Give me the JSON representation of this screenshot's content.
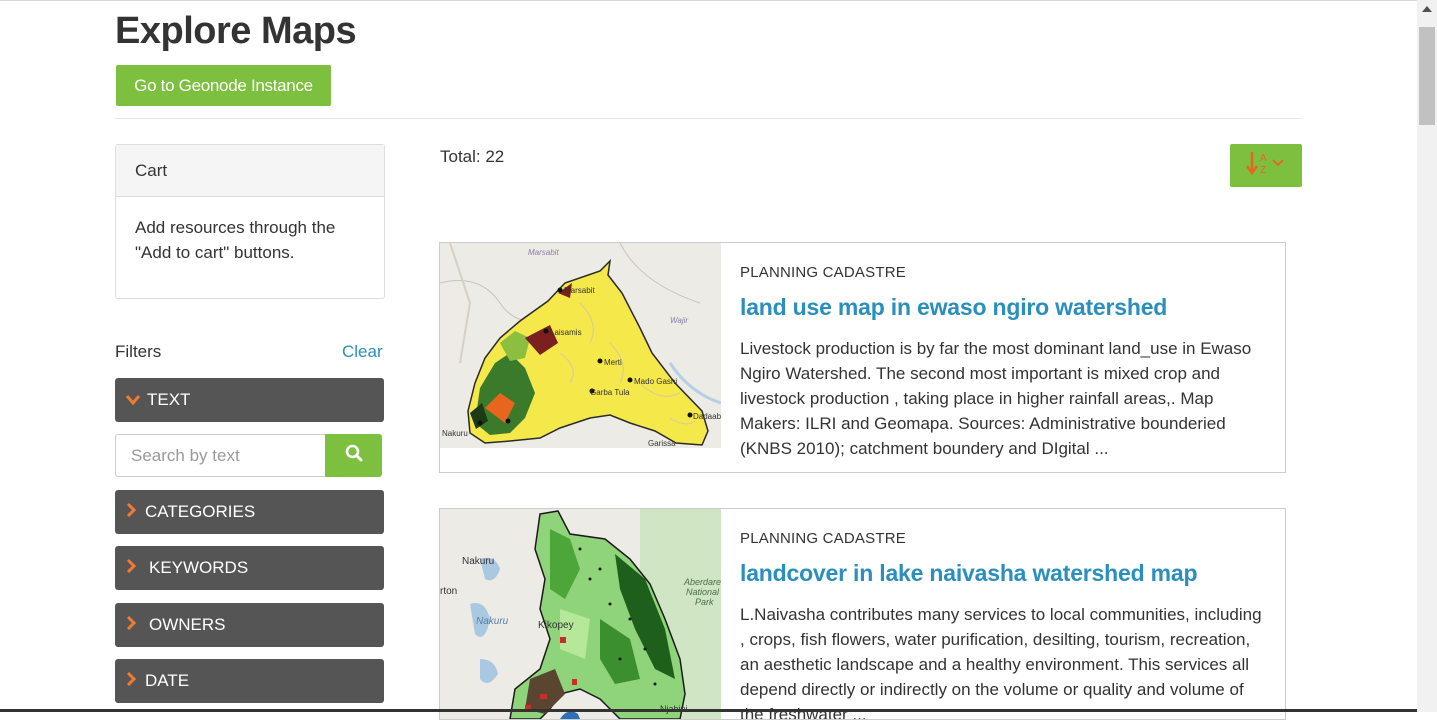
{
  "page": {
    "title": "Explore Maps"
  },
  "header": {
    "geonode_button": "Go to Geonode Instance"
  },
  "cart": {
    "title": "Cart",
    "message": "Add resources through the \"Add to cart\" buttons."
  },
  "filters": {
    "title": "Filters",
    "clear": "Clear",
    "text_facet": "TEXT",
    "search_placeholder": "Search by text",
    "facets": [
      "CATEGORIES",
      "KEYWORDS",
      "OWNERS",
      "DATE"
    ]
  },
  "results": {
    "total": "Total: 22",
    "items": [
      {
        "category": "PLANNING CADASTRE",
        "title": "land use map in ewaso ngiro watershed",
        "description": "Livestock production is by far the most dominant land_use in Ewaso Ngiro Watershed. The second most important is mixed crop and livestock production , taking place in higher rainfall areas,. Map Makers: ILRI and Geomapa. Sources: Administrative bounderied (KNBS 2010); catchment boundery and DIgital ...",
        "map_labels": [
          "Marsabit",
          "Laisamis",
          "Merti",
          "Garba Tula",
          "Modo Gashi",
          "Dadaab",
          "Wajir",
          "Nakuru",
          "Garissa"
        ]
      },
      {
        "category": "PLANNING CADASTRE",
        "title": "landcover in lake naivasha watershed map",
        "description": "L.Naivasha contributes many services to local communities, including , crops, fish flowers, water purification, desilting, tourism, recreation, an aesthetic landscape and a healthy environment. This services all depend directly or indirectly on the volume or quality and volume of the freshwater ...",
        "map_labels": [
          "Nakuru",
          "Nakuru",
          "Kikopey",
          "Aberdare National Park",
          "Njabini"
        ]
      }
    ]
  },
  "colors": {
    "accent": "#7dbf3e",
    "link": "#2a8fbd",
    "facet_bg": "#555555",
    "chevron": "#ef7b30"
  },
  "icons": {
    "search": "search-icon",
    "sort": "sort-alpha-icon",
    "chevron": "chevron-right-icon"
  }
}
